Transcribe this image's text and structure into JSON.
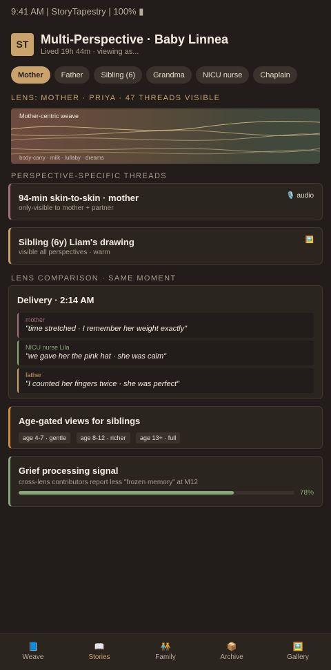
{
  "status_bar": {
    "text": "9:41 AM | StoryTapestry | 100% ▮"
  },
  "header": {
    "avatar": "ST",
    "title": "Multi-Perspective · Baby Linnea",
    "subtitle": "Lived 19h 44m · viewing as..."
  },
  "perspectives": [
    "Mother",
    "Father",
    "Sibling (6)",
    "Grandma",
    "NICU nurse",
    "Chaplain"
  ],
  "active_perspective": "Mother",
  "lens": {
    "label": "Lens: Mother · Priya · 47 threads visible",
    "weave_title": "Mother-centric weave",
    "weave_footer": "body-carry · milk · lullaby · dreams"
  },
  "threads_section": {
    "label": "Perspective-specific threads",
    "threads": [
      {
        "title": "94-min skin-to-skin · mother",
        "subtitle": "only-visible to mother + partner",
        "tag": "audio",
        "tag_icon": "microphone-icon"
      },
      {
        "title": "Sibling (6y) Liam's drawing",
        "subtitle": "visible all perspectives · warm",
        "tag": "",
        "tag_icon": "picture-icon"
      }
    ]
  },
  "comparison": {
    "label": "Lens comparison · same moment",
    "moment": "Delivery · 2:14 AM",
    "quotes": [
      {
        "who": "mother",
        "what": "\"time stretched · I remember her weight exactly\"",
        "color": "#a2707a"
      },
      {
        "who": "NICU nurse Lila",
        "what": "\"we gave her the pink hat · she was calm\"",
        "color": "#8aa77c"
      },
      {
        "who": "father",
        "what": "\"I counted her fingers twice · she was perfect\"",
        "color": "#c9a36b"
      }
    ]
  },
  "age_gated": {
    "title": "Age-gated views for siblings",
    "chips": [
      "age 4-7 · gentle",
      "age 8-12 · richer",
      "age 13+ · full"
    ]
  },
  "grief": {
    "title": "Grief processing signal",
    "subtitle": "cross-lens contributors report less \"frozen memory\" at M12",
    "progress": 0.78,
    "progress_label": "78%"
  },
  "nav": [
    {
      "label": "Weave",
      "icon": "book-icon",
      "glyph": "📘"
    },
    {
      "label": "Stories",
      "icon": "open-book-icon",
      "glyph": "📖"
    },
    {
      "label": "Family",
      "icon": "family-icon",
      "glyph": "🧑‍🤝‍🧑"
    },
    {
      "label": "Archive",
      "icon": "box-icon",
      "glyph": "📦"
    },
    {
      "label": "Gallery",
      "icon": "gallery-icon",
      "glyph": "🖼️"
    }
  ],
  "active_nav": "Stories",
  "colors": {
    "accent": "#c9a36b",
    "mother": "#a2707a",
    "nurse": "#8aa77c",
    "age": "#d08a3a"
  }
}
